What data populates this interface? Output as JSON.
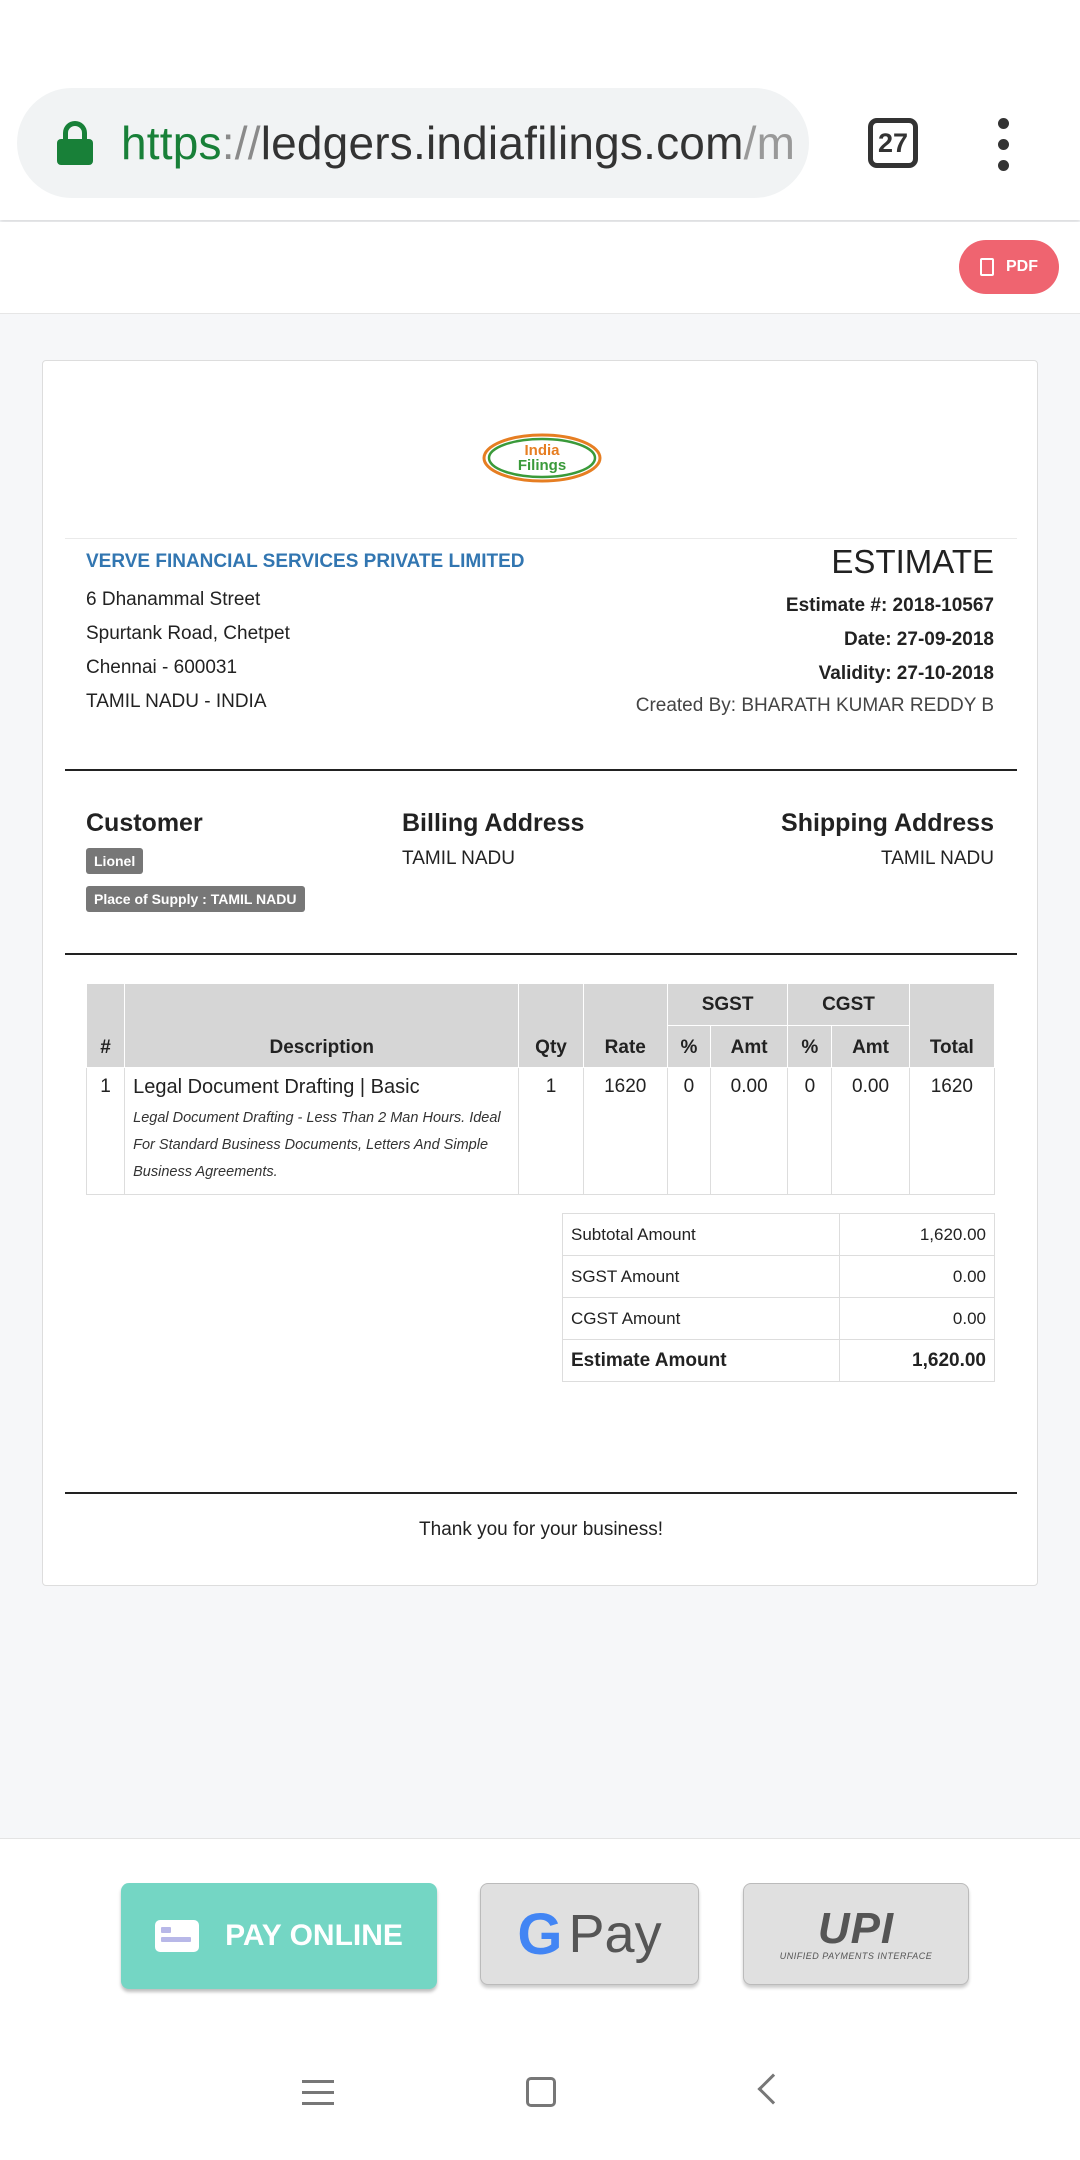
{
  "browser": {
    "url_scheme": "https",
    "url_sep": "://",
    "url_host": "ledgers.indiafilings.com",
    "url_path": "/m",
    "tab_count": "27"
  },
  "toolbar": {
    "pdf_label": "PDF"
  },
  "logo": {
    "line1": "India",
    "line2": "Filings"
  },
  "company": {
    "name": "VERVE FINANCIAL SERVICES PRIVATE LIMITED",
    "address": [
      "6 Dhanammal Street",
      "Spurtank Road, Chetpet",
      "Chennai - 600031",
      "TAMIL NADU - INDIA"
    ]
  },
  "estimate": {
    "title": "ESTIMATE",
    "number": "Estimate #: 2018-10567",
    "date": "Date: 27-09-2018",
    "validity": "Validity: 27-10-2018",
    "created_by": "Created By: BHARATH KUMAR REDDY B"
  },
  "customer": {
    "heading": "Customer",
    "name": "Lionel",
    "place_of_supply": "Place of Supply : TAMIL NADU"
  },
  "billing": {
    "heading": "Billing Address",
    "value": "TAMIL NADU"
  },
  "shipping": {
    "heading": "Shipping Address",
    "value": "TAMIL NADU"
  },
  "items_table": {
    "headers": {
      "num": "#",
      "description": "Description",
      "qty": "Qty",
      "rate": "Rate",
      "sgst": "SGST",
      "cgst": "CGST",
      "pct": "%",
      "amt": "Amt",
      "total": "Total"
    },
    "rows": [
      {
        "num": "1",
        "title": "Legal Document Drafting | Basic",
        "subtitle": "Legal Document Drafting - Less Than 2 Man Hours. Ideal For Standard Business Documents, Letters And Simple Business Agreements.",
        "qty": "1",
        "rate": "1620",
        "sgst_pct": "0",
        "sgst_amt": "0.00",
        "cgst_pct": "0",
        "cgst_amt": "0.00",
        "total": "1620"
      }
    ]
  },
  "totals": [
    {
      "label": "Subtotal Amount",
      "value": "1,620.00"
    },
    {
      "label": "SGST Amount",
      "value": "0.00"
    },
    {
      "label": "CGST Amount",
      "value": "0.00"
    },
    {
      "label": "Estimate Amount",
      "value": "1,620.00"
    }
  ],
  "footer": {
    "thanks": "Thank you for your business!"
  },
  "pay": {
    "online_label": "PAY ONLINE",
    "gpay_g": "G",
    "gpay_label": "Pay",
    "upi_mark": "UPI",
    "upi_sub": "UNIFIED PAYMENTS INTERFACE"
  },
  "colors": {
    "link_blue": "#3276b1",
    "pdf_red": "#ef6470",
    "pay_teal": "#74d6c4",
    "secure_green": "#188038"
  }
}
